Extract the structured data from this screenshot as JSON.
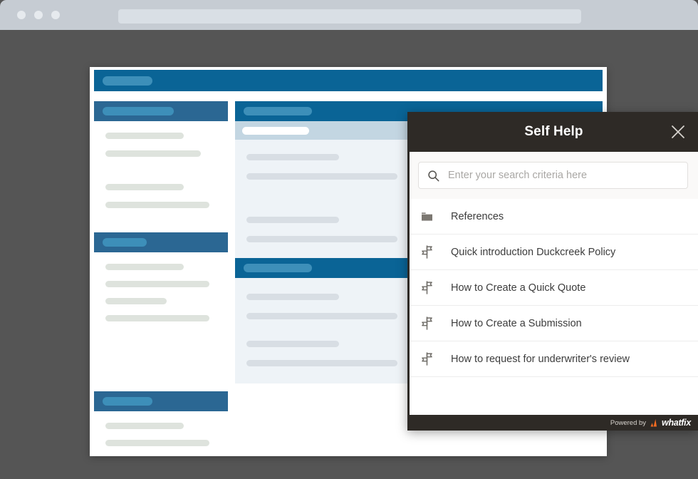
{
  "browser": {
    "dots": [
      "close-dot",
      "minimize-dot",
      "maximize-dot"
    ],
    "address_value": ""
  },
  "app_window": {
    "topbar_label": "",
    "left_column": {
      "sections": [
        {
          "header_label": "",
          "lines": 4
        },
        {
          "header_label": "",
          "lines": 4
        },
        {
          "header_label": "",
          "lines": 2
        }
      ]
    },
    "right_column": {
      "sections": [
        {
          "header_label": "",
          "selected_row_label": "",
          "lines": 4
        },
        {
          "header_label": "",
          "lines": 4
        }
      ]
    }
  },
  "widget": {
    "title": "Self Help",
    "close_label": "×",
    "search": {
      "placeholder": "Enter your search criteria here",
      "value": "",
      "icon": "search-icon"
    },
    "results": [
      {
        "label": "References",
        "icon": "folder-icon",
        "type": "folder"
      },
      {
        "label": "Quick introduction Duckcreek Policy",
        "icon": "signpost-icon",
        "type": "flow"
      },
      {
        "label": "How to Create a Quick Quote",
        "icon": "signpost-icon",
        "type": "flow"
      },
      {
        "label": "How to Create a Submission",
        "icon": "signpost-icon",
        "type": "flow"
      },
      {
        "label": "How to request for underwriter's review",
        "icon": "signpost-icon",
        "type": "flow"
      }
    ],
    "footer": {
      "powered_by": "Powered by",
      "brand": "whatfix",
      "brand_mark_color": "#f26b21"
    }
  },
  "colors": {
    "desktop_bg": "#555555",
    "chrome_bg": "#c6ccd3",
    "widget_dark": "#2e2a26",
    "accent_blue": "#0a6496",
    "panel_blue": "#2b6793",
    "pill_blue": "#3d8fb9",
    "selected_row": "#c3d6e2",
    "tinted_panel": "#eef3f7"
  }
}
